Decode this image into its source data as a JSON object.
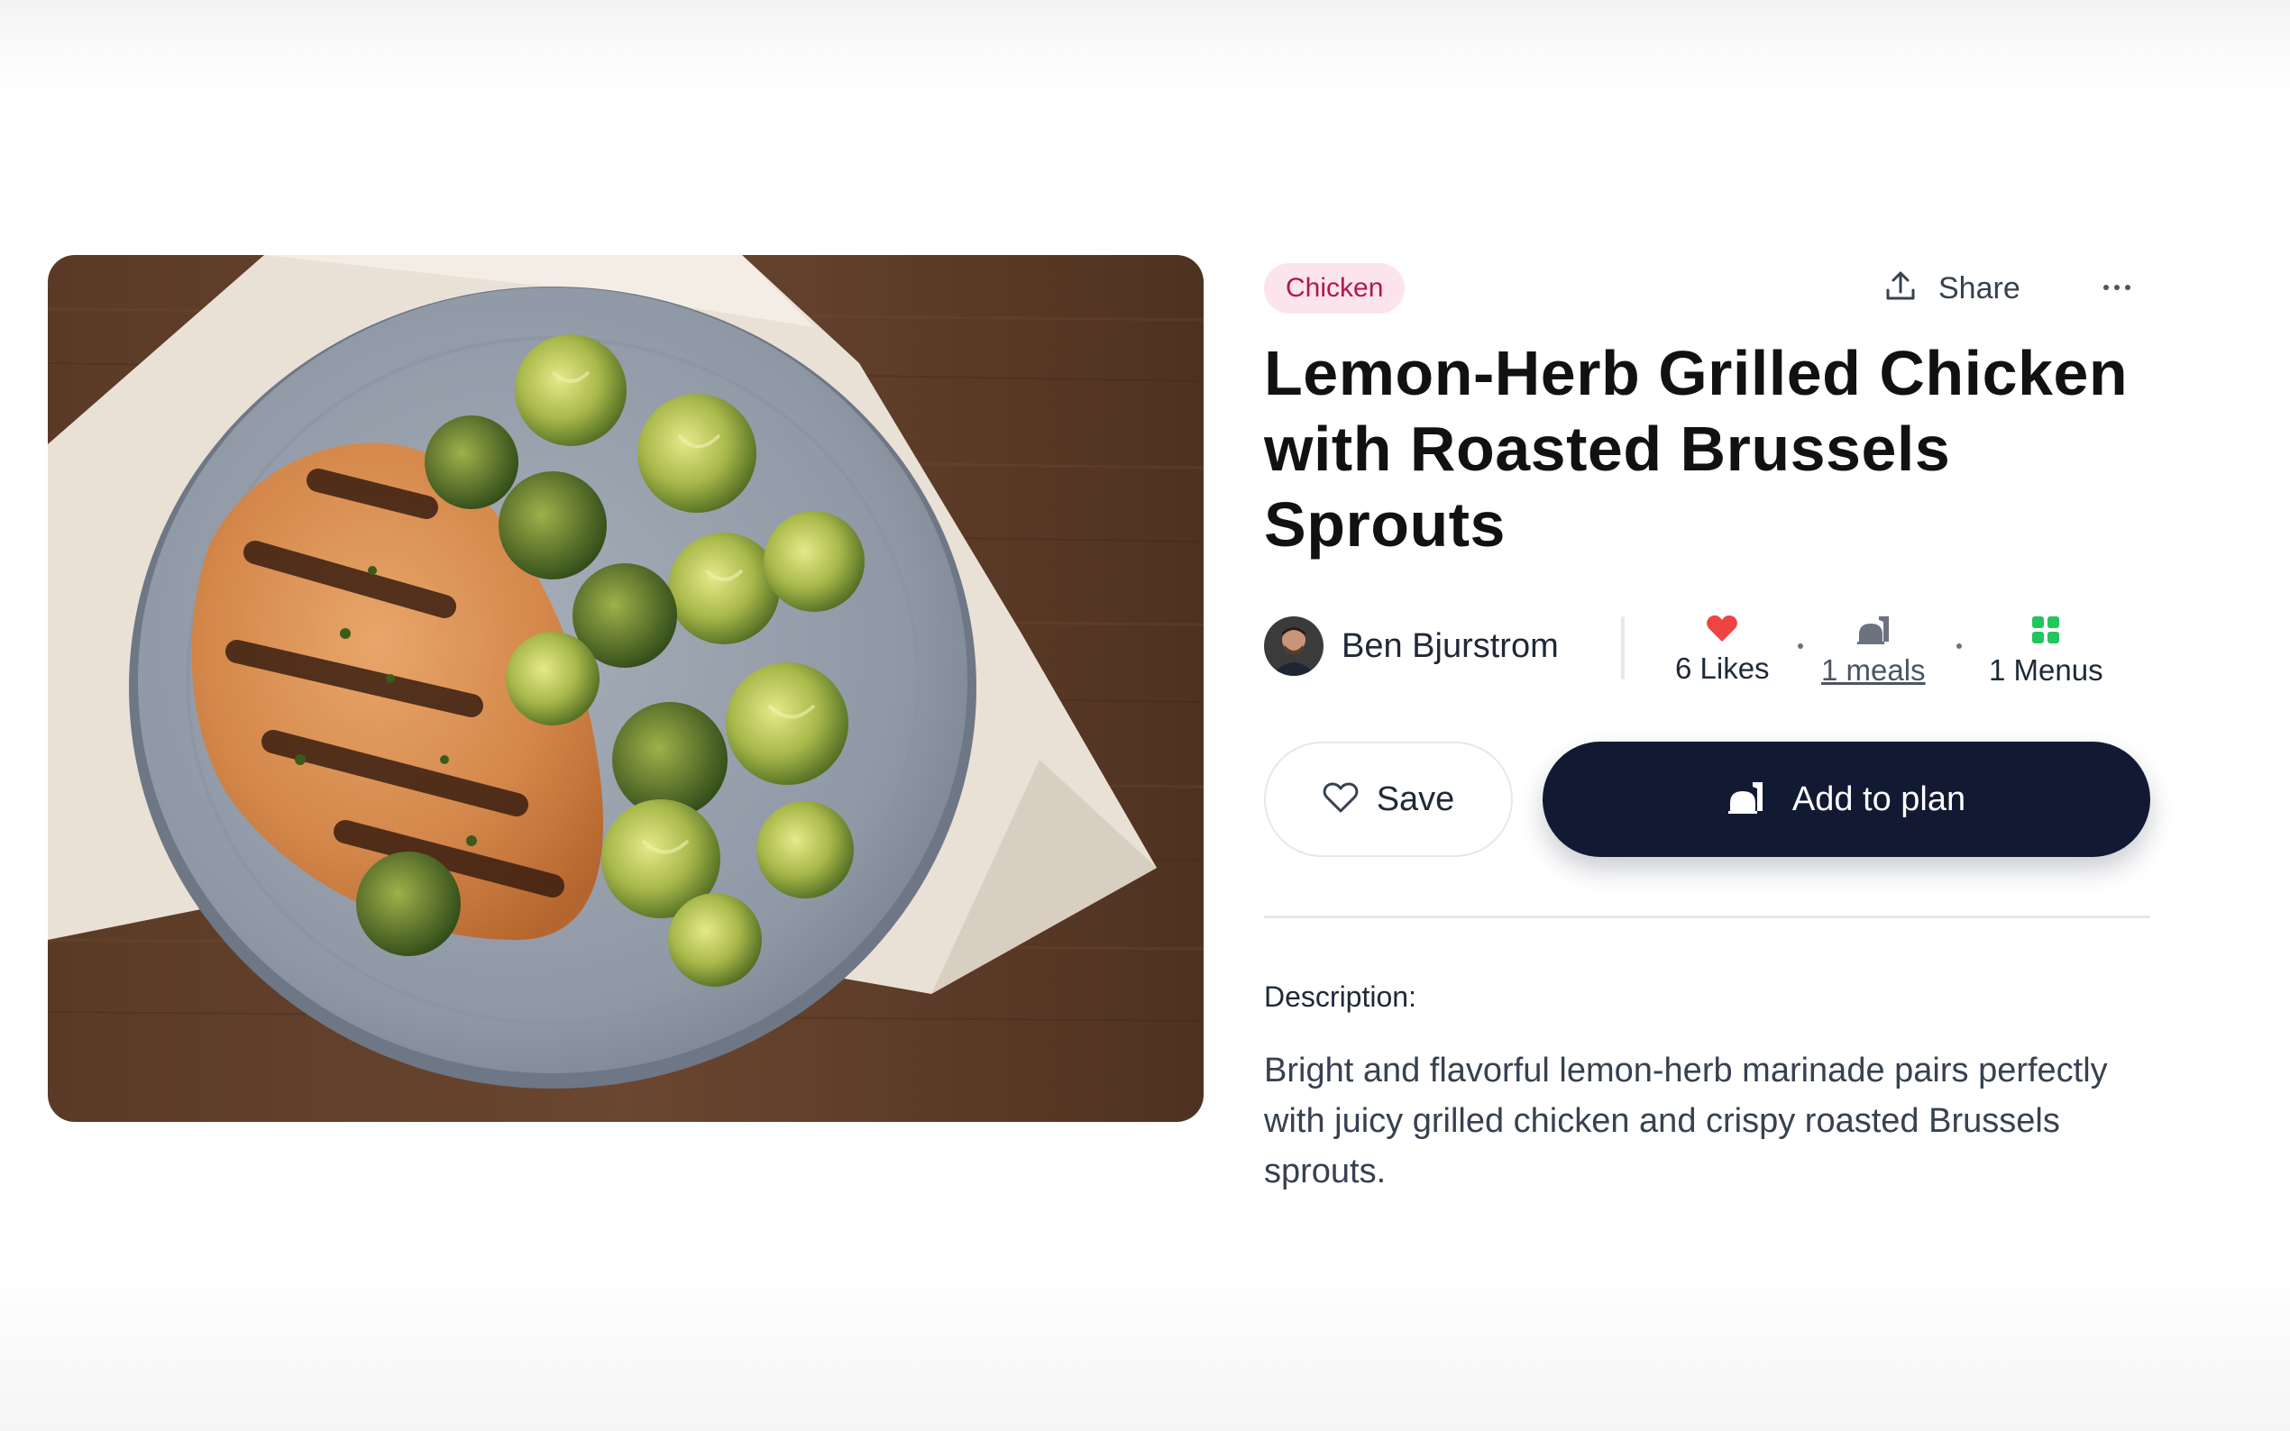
{
  "recipe": {
    "category": "Chicken",
    "title": "Lemon-Herb Grilled Chicken with Roasted Brussels Sprouts",
    "image_alt": "Grilled chicken breast with roasted Brussels sprouts on a grey plate",
    "author": {
      "name": "Ben Bjurstrom"
    },
    "stats": {
      "likes": "6 Likes",
      "meals": "1 meals",
      "menus": "1 Menus"
    },
    "description_heading": "Description:",
    "description": "Bright and flavorful lemon-herb marinade pairs perfectly with juicy grilled chicken and crispy roasted Brussels sprouts."
  },
  "actions": {
    "share_label": "Share",
    "more_label": "⋯",
    "save_label": "Save",
    "add_to_plan_label": "Add to plan"
  },
  "icons": {
    "share": "share-upload-icon",
    "more": "more-horizontal-icon",
    "heart": "heart-icon",
    "meals": "meal-plate-icon",
    "menus": "grid-icon",
    "save": "heart-outline-icon",
    "add_to_plan": "meal-plate-icon"
  },
  "colors": {
    "category_bg": "#fce4ec",
    "category_text": "#b0174f",
    "primary_button": "#121a33",
    "heart": "#ef4444",
    "menus_icon": "#22c55e"
  }
}
